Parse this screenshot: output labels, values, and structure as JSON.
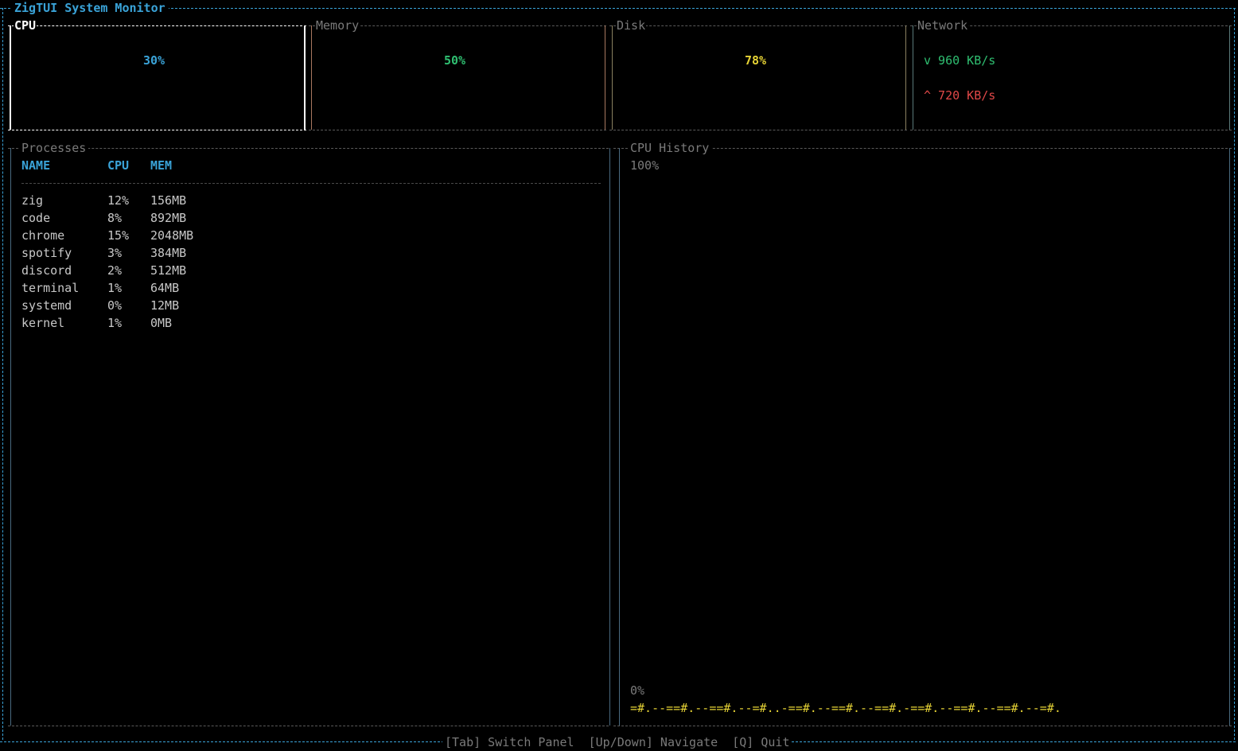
{
  "app": {
    "title": "ZigTUI System Monitor"
  },
  "panels": {
    "cpu": {
      "title": "CPU",
      "percent": "30%",
      "usage": 0.3,
      "bar_fill": "###########",
      "bar_track": "---------------------------"
    },
    "memory": {
      "title": "Memory",
      "percent": "50%",
      "usage": 0.5,
      "bar_fill": "###################",
      "bar_track": "-------------------"
    },
    "disk": {
      "title": "Disk",
      "percent": "78%",
      "usage": 0.78,
      "bar_fill": "#############################",
      "bar_track": "---------"
    },
    "network": {
      "title": "Network",
      "down": "v 960 KB/s",
      "up": "^ 720 KB/s"
    }
  },
  "processes": {
    "title": "Processes",
    "headers": {
      "name": "NAME",
      "cpu": "CPU",
      "mem": "MEM"
    },
    "rows": [
      {
        "name": "zig",
        "cpu": "12%",
        "mem": "156MB"
      },
      {
        "name": "code",
        "cpu": "8%",
        "mem": "892MB"
      },
      {
        "name": "chrome",
        "cpu": "15%",
        "mem": "2048MB"
      },
      {
        "name": "spotify",
        "cpu": "3%",
        "mem": "384MB"
      },
      {
        "name": "discord",
        "cpu": "2%",
        "mem": "512MB"
      },
      {
        "name": "terminal",
        "cpu": "1%",
        "mem": "64MB"
      },
      {
        "name": "systemd",
        "cpu": "0%",
        "mem": "12MB"
      },
      {
        "name": "kernel",
        "cpu": "1%",
        "mem": "0MB"
      }
    ]
  },
  "history": {
    "title": "CPU History",
    "max_label": "100%",
    "min_label": "0%",
    "sparkline": "=#.--==#.--==#.--=#..-==#.--==#.--==#.-==#.--==#.--==#.--=#."
  },
  "footer": {
    "help": "[Tab] Switch Panel  [Up/Down] Navigate  [Q] Quit"
  },
  "colors": {
    "accent": "#3aa3d8",
    "cpu": "#3aa3d8",
    "memory": "#2fbf71",
    "disk": "#e5d235",
    "net_down": "#2fbf71",
    "net_up": "#e04848"
  }
}
